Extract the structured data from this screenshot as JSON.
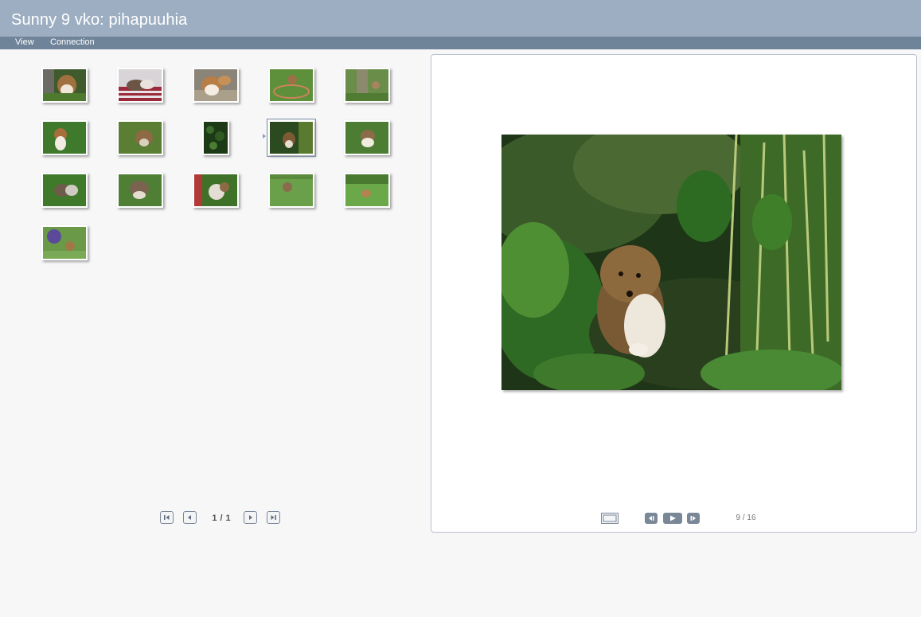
{
  "window": {
    "title": "Sunny 9 vko: pihapuuhia"
  },
  "menu": {
    "items": [
      "View",
      "Connection"
    ]
  },
  "gallery": {
    "thumbnail_count": 16,
    "selected_index": 9
  },
  "pager": {
    "current": "1",
    "separator": "/",
    "total": "1"
  },
  "viewer": {
    "counter": "9 / 16"
  },
  "icons": {
    "pager_first": "first-page-icon",
    "pager_prev": "previous-page-icon",
    "pager_next": "next-page-icon",
    "pager_last": "last-page-icon",
    "fullscreen": "fullscreen-icon",
    "prev_image": "previous-image-icon",
    "play": "play-icon",
    "next_image": "next-image-icon"
  },
  "colors": {
    "titlebar": "#9daec2",
    "menubar": "#6f8399",
    "background": "#f7f7f7",
    "control": "#7a8797"
  }
}
